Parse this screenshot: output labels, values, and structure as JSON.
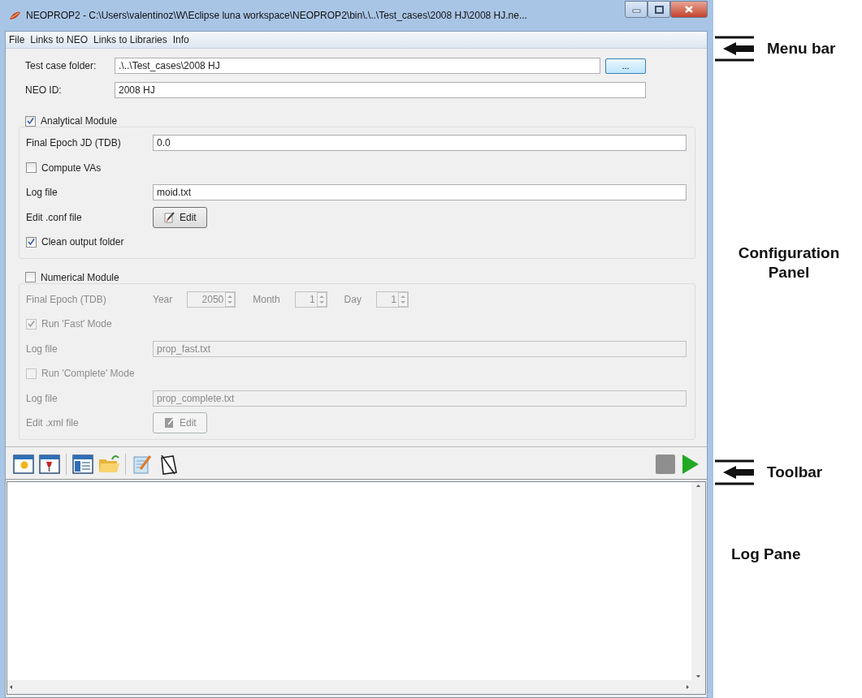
{
  "window": {
    "title": "NEOPROP2 - C:\\Users\\valentinoz\\W\\Eclipse luna workspace\\NEOPROP2\\bin\\.\\..\\Test_cases\\2008 HJ\\2008 HJ.ne..."
  },
  "menu": [
    "File",
    "Links to NEO",
    "Links to Libraries",
    "Info"
  ],
  "fields": [
    {
      "label": "Test case folder:",
      "value": ".\\..\\Test_cases\\2008 HJ",
      "browse": "..."
    },
    {
      "label": "NEO ID:",
      "value": "2008 HJ"
    }
  ],
  "modules": [
    {
      "title": "Analytical Module",
      "checked": true,
      "disabled": false,
      "rows": [
        {
          "kind": "field",
          "label": "Final Epoch JD (TDB)",
          "value": "0.0"
        },
        {
          "kind": "check",
          "label": "Compute VAs",
          "checked": false
        },
        {
          "kind": "field",
          "label": "Log file",
          "value": "moid.txt"
        },
        {
          "kind": "button",
          "label": "Edit .conf file",
          "button": "Edit"
        },
        {
          "kind": "check",
          "label": "Clean output folder",
          "checked": true
        }
      ]
    },
    {
      "title": "Numerical Module",
      "checked": false,
      "disabled": true,
      "rows": [
        {
          "kind": "date",
          "label": "Final Epoch (TDB)",
          "parts": [
            {
              "label": "Year",
              "value": "2050"
            },
            {
              "label": "Month",
              "value": "1"
            },
            {
              "label": "Day",
              "value": "1"
            }
          ]
        },
        {
          "kind": "check",
          "label": "Run 'Fast' Mode",
          "checked": true
        },
        {
          "kind": "field",
          "label": "Log file",
          "value": "prop_fast.txt"
        },
        {
          "kind": "check",
          "label": "Run 'Complete' Mode",
          "checked": false
        },
        {
          "kind": "field",
          "label": "Log file",
          "value": "prop_complete.txt"
        },
        {
          "kind": "button",
          "label": "Edit .xml file",
          "button": "Edit"
        }
      ]
    }
  ],
  "annotations": [
    {
      "text": "Menu bar",
      "arrow": true
    },
    {
      "text": "Configuration Panel",
      "arrow": false
    },
    {
      "text": "Toolbar",
      "arrow": true
    },
    {
      "text": "Log Pane",
      "arrow": false
    }
  ]
}
